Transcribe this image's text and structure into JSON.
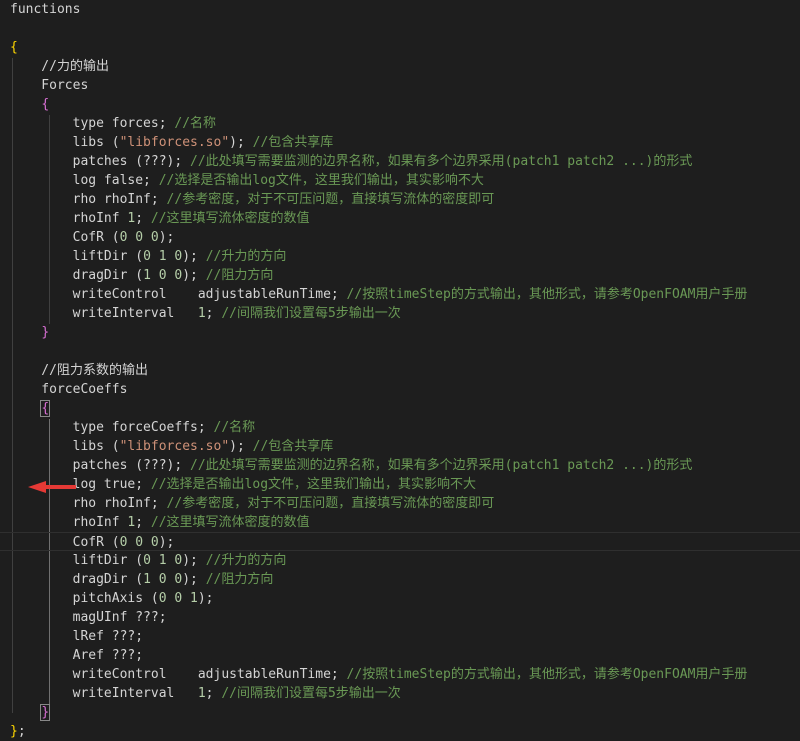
{
  "lines": [
    {
      "segs": [
        {
          "t": "functions",
          "c": "k"
        }
      ]
    },
    {
      "segs": []
    },
    {
      "segs": [
        {
          "t": "{",
          "c": "b1"
        }
      ]
    },
    {
      "segs": [
        {
          "t": "    //力的输出",
          "c": "k"
        }
      ]
    },
    {
      "segs": [
        {
          "t": "    Forces",
          "c": "k"
        }
      ]
    },
    {
      "segs": [
        {
          "t": "    ",
          "c": "k"
        },
        {
          "t": "{",
          "c": "b2"
        }
      ]
    },
    {
      "segs": [
        {
          "t": "        type forces",
          "c": "k"
        },
        {
          "t": "; ",
          "c": "p"
        },
        {
          "t": "//名称",
          "c": "c"
        }
      ]
    },
    {
      "segs": [
        {
          "t": "        libs (",
          "c": "k"
        },
        {
          "t": "\"libforces.so\"",
          "c": "s"
        },
        {
          "t": "); ",
          "c": "p"
        },
        {
          "t": "//包含共享库",
          "c": "c"
        }
      ]
    },
    {
      "segs": [
        {
          "t": "        patches (???); ",
          "c": "k"
        },
        {
          "t": "//此处填写需要监测的边界名称，如果有多个边界采用(patch1 patch2 ...)的形式",
          "c": "c"
        }
      ]
    },
    {
      "segs": [
        {
          "t": "        log false; ",
          "c": "k"
        },
        {
          "t": "//选择是否输出log文件，这里我们输出，其实影响不大",
          "c": "c"
        }
      ]
    },
    {
      "segs": [
        {
          "t": "        rho rhoInf; ",
          "c": "k"
        },
        {
          "t": "//参考密度，对于不可压问题，直接填写流体的密度即可",
          "c": "c"
        }
      ]
    },
    {
      "segs": [
        {
          "t": "        rhoInf ",
          "c": "k"
        },
        {
          "t": "1",
          "c": "n"
        },
        {
          "t": "; ",
          "c": "p"
        },
        {
          "t": "//这里填写流体密度的数值",
          "c": "c"
        }
      ]
    },
    {
      "segs": [
        {
          "t": "        CofR (",
          "c": "k"
        },
        {
          "t": "0 0 0",
          "c": "n"
        },
        {
          "t": ");",
          "c": "p"
        }
      ]
    },
    {
      "segs": [
        {
          "t": "        liftDir (",
          "c": "k"
        },
        {
          "t": "0 1 0",
          "c": "n"
        },
        {
          "t": "); ",
          "c": "p"
        },
        {
          "t": "//升力的方向",
          "c": "c"
        }
      ]
    },
    {
      "segs": [
        {
          "t": "        dragDir (",
          "c": "k"
        },
        {
          "t": "1 0 0",
          "c": "n"
        },
        {
          "t": "); ",
          "c": "p"
        },
        {
          "t": "//阻力方向",
          "c": "c"
        }
      ]
    },
    {
      "segs": [
        {
          "t": "        writeControl    adjustableRunTime; ",
          "c": "k"
        },
        {
          "t": "//按照timeStep的方式输出，其他形式，请参考OpenFOAM用户手册",
          "c": "c"
        }
      ]
    },
    {
      "segs": [
        {
          "t": "        writeInterval   ",
          "c": "k"
        },
        {
          "t": "1",
          "c": "n"
        },
        {
          "t": "; ",
          "c": "p"
        },
        {
          "t": "//间隔我们设置每5步输出一次",
          "c": "c"
        }
      ]
    },
    {
      "segs": [
        {
          "t": "    ",
          "c": "k"
        },
        {
          "t": "}",
          "c": "b2"
        }
      ]
    },
    {
      "segs": []
    },
    {
      "segs": [
        {
          "t": "    //阻力系数的输出",
          "c": "k"
        }
      ]
    },
    {
      "segs": [
        {
          "t": "    forceCoeffs",
          "c": "k"
        }
      ]
    },
    {
      "segs": [
        {
          "t": "    ",
          "c": "k"
        },
        {
          "t": "{",
          "c": "b2",
          "m": true
        }
      ]
    },
    {
      "segs": [
        {
          "t": "        type forceCoeffs",
          "c": "k"
        },
        {
          "t": "; ",
          "c": "p"
        },
        {
          "t": "//名称",
          "c": "c"
        }
      ]
    },
    {
      "segs": [
        {
          "t": "        libs (",
          "c": "k"
        },
        {
          "t": "\"libforces.so\"",
          "c": "s"
        },
        {
          "t": "); ",
          "c": "p"
        },
        {
          "t": "//包含共享库",
          "c": "c"
        }
      ]
    },
    {
      "segs": [
        {
          "t": "        patches (???); ",
          "c": "k"
        },
        {
          "t": "//此处填写需要监测的边界名称，如果有多个边界采用(patch1 patch2 ...)的形式",
          "c": "c"
        }
      ]
    },
    {
      "segs": [
        {
          "t": "        log true; ",
          "c": "k"
        },
        {
          "t": "//选择是否输出log文件，这里我们输出，其实影响不大",
          "c": "c"
        }
      ]
    },
    {
      "segs": [
        {
          "t": "        rho rhoInf; ",
          "c": "k"
        },
        {
          "t": "//参考密度，对于不可压问题，直接填写流体的密度即可",
          "c": "c"
        }
      ]
    },
    {
      "segs": [
        {
          "t": "        rhoInf ",
          "c": "k"
        },
        {
          "t": "1",
          "c": "n"
        },
        {
          "t": "; ",
          "c": "p"
        },
        {
          "t": "//这里填写流体密度的数值",
          "c": "c"
        }
      ]
    },
    {
      "segs": [
        {
          "t": "        CofR (",
          "c": "k"
        },
        {
          "t": "0 0 0",
          "c": "n"
        },
        {
          "t": ");",
          "c": "p"
        }
      ],
      "current": true
    },
    {
      "segs": [
        {
          "t": "        liftDir (",
          "c": "k"
        },
        {
          "t": "0 1 0",
          "c": "n"
        },
        {
          "t": "); ",
          "c": "p"
        },
        {
          "t": "//升力的方向",
          "c": "c"
        }
      ]
    },
    {
      "segs": [
        {
          "t": "        dragDir (",
          "c": "k"
        },
        {
          "t": "1 0 0",
          "c": "n"
        },
        {
          "t": "); ",
          "c": "p"
        },
        {
          "t": "//阻力方向",
          "c": "c"
        }
      ]
    },
    {
      "segs": [
        {
          "t": "        pitchAxis (",
          "c": "k"
        },
        {
          "t": "0 0 1",
          "c": "n"
        },
        {
          "t": ");",
          "c": "p"
        }
      ]
    },
    {
      "segs": [
        {
          "t": "        magUInf ???;",
          "c": "k"
        }
      ]
    },
    {
      "segs": [
        {
          "t": "        lRef ???;",
          "c": "k"
        }
      ]
    },
    {
      "segs": [
        {
          "t": "        Aref ???;",
          "c": "k"
        }
      ]
    },
    {
      "segs": [
        {
          "t": "        writeControl    adjustableRunTime; ",
          "c": "k"
        },
        {
          "t": "//按照timeStep的方式输出，其他形式，请参考OpenFOAM用户手册",
          "c": "c"
        }
      ]
    },
    {
      "segs": [
        {
          "t": "        writeInterval   ",
          "c": "k"
        },
        {
          "t": "1",
          "c": "n"
        },
        {
          "t": "; ",
          "c": "p"
        },
        {
          "t": "//间隔我们设置每5步输出一次",
          "c": "c"
        }
      ]
    },
    {
      "segs": [
        {
          "t": "    ",
          "c": "k"
        },
        {
          "t": "}",
          "c": "b2",
          "m": true
        }
      ]
    },
    {
      "segs": [
        {
          "t": "}",
          "c": "b1"
        },
        {
          "t": ";",
          "c": "p"
        }
      ]
    }
  ],
  "colors": {
    "background": "#1e1e1e",
    "text": "#d4d4d4",
    "comment": "#6a9955",
    "string": "#ce9178",
    "number": "#b5cea8",
    "bracket_outer": "#ffd700",
    "bracket_inner": "#da70d6",
    "arrow": "#e53935"
  },
  "annotation": {
    "icon": "red-arrow-icon"
  }
}
